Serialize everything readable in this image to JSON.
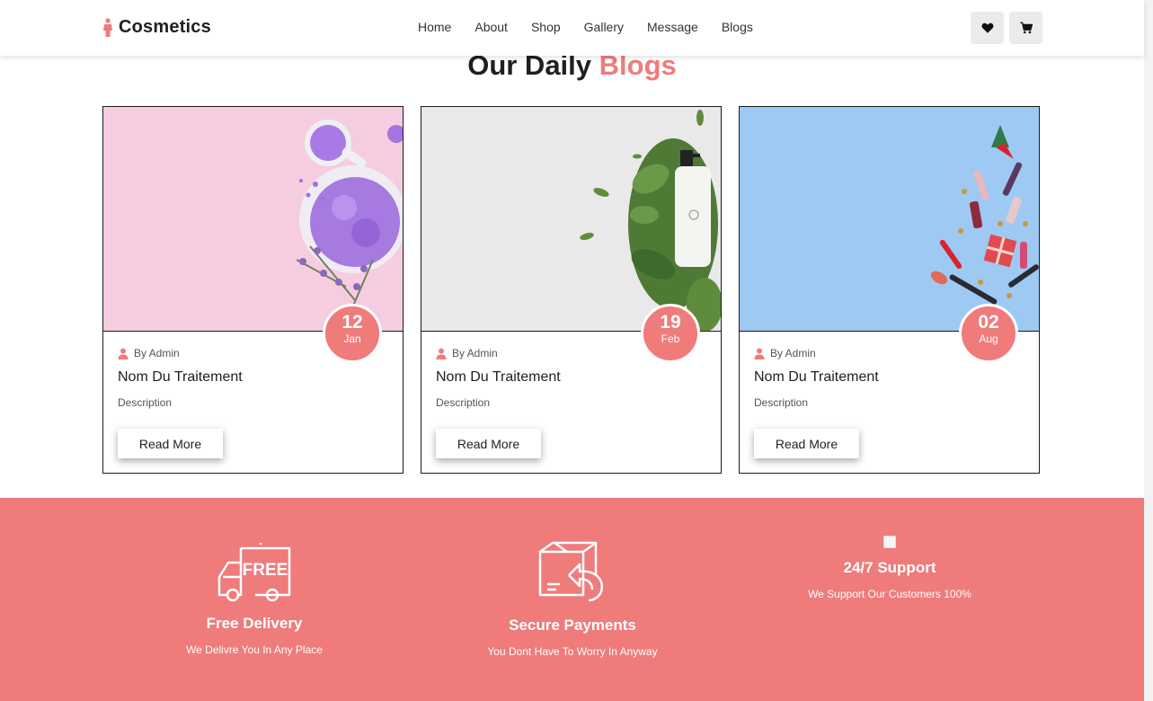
{
  "brand": {
    "name": "Cosmetics"
  },
  "nav": {
    "items": [
      "Home",
      "About",
      "Shop",
      "Gallery",
      "Message",
      "Blogs"
    ]
  },
  "actions": {
    "wishlist_icon": "heart-icon",
    "cart_icon": "cart-icon"
  },
  "section": {
    "title_main": "Our Daily",
    "title_accent": "Blogs"
  },
  "blogs": [
    {
      "day": "12",
      "month": "Jan",
      "author": "By Admin",
      "title": "Nom Du Traitement",
      "description": "Description",
      "button": "Read More"
    },
    {
      "day": "19",
      "month": "Feb",
      "author": "By Admin",
      "title": "Nom Du Traitement",
      "description": "Description",
      "button": "Read More"
    },
    {
      "day": "02",
      "month": "Aug",
      "author": "By Admin",
      "title": "Nom Du Traitement",
      "description": "Description",
      "button": "Read More"
    }
  ],
  "features": [
    {
      "icon": "delivery-truck-icon",
      "title": "Free Delivery",
      "subtitle": "We Delivre You In Any Place"
    },
    {
      "icon": "secure-box-icon",
      "title": "Secure Payments",
      "subtitle": "You Dont Have To Worry In Anyway"
    },
    {
      "icon": "broken-image-icon",
      "title": "24/7 Support",
      "subtitle": "We Support Our Customers 100%"
    }
  ],
  "colors": {
    "accent": "#ef7b7b",
    "dark": "#1f1f1f"
  }
}
